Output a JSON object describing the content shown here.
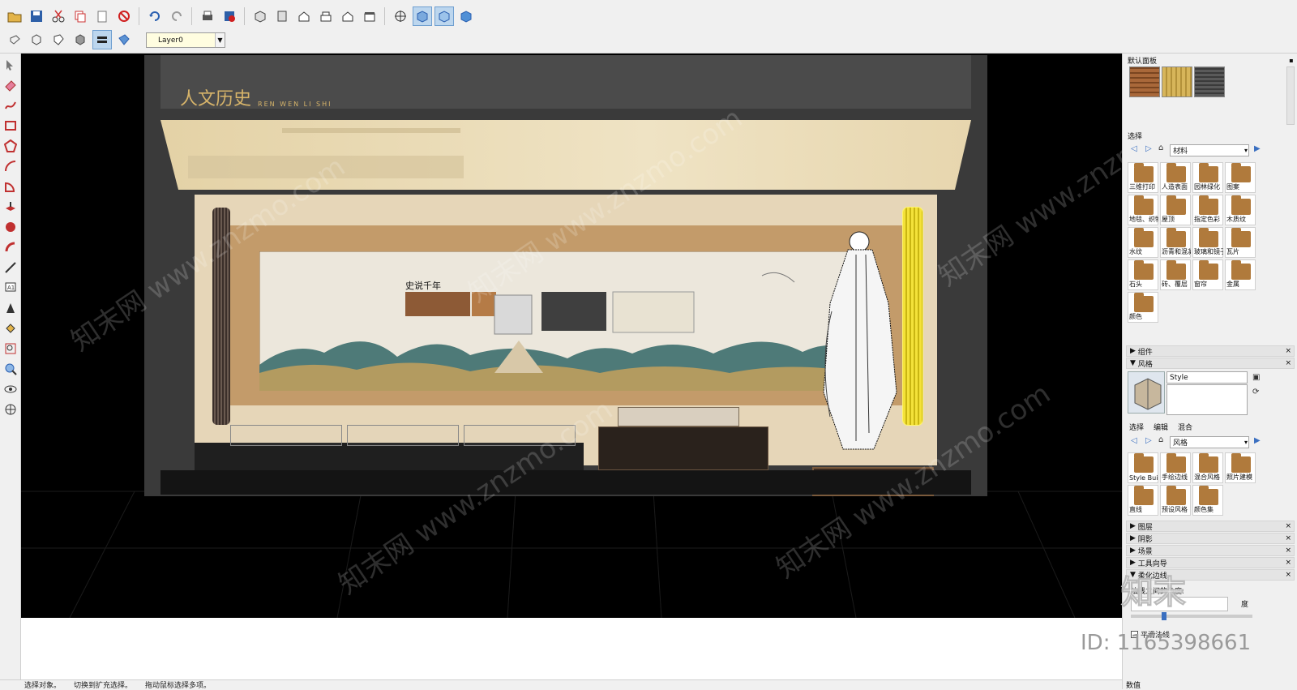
{
  "toolbar": {
    "layer_value": "Layer0"
  },
  "status": {
    "items": [
      "选择对象。",
      "切换到扩充选择。",
      "拖动鼠标选择多项。"
    ],
    "measurement_label": "数值"
  },
  "scene": {
    "title": "人文历史",
    "subtitle": "REN WEN LI SHI",
    "scroll_title": "史说千年",
    "watermark": "知末网 www.znzmo.com"
  },
  "panel": {
    "tray_title": "默认面板",
    "select_label": "选择",
    "material_combo": "材料",
    "materials": [
      "三维打印",
      "人造表面",
      "园林绿化",
      "图案",
      "地毯、织物",
      "屋顶",
      "指定色彩",
      "木质纹",
      "水纹",
      "沥青和混凝土",
      "玻璃和镜子",
      "瓦片",
      "石头",
      "砖、覆层",
      "窗帘",
      "金属",
      "颜色"
    ],
    "components_label": "组件",
    "styles_label": "风格",
    "style_name": "Style",
    "style_tabs": [
      "选择",
      "编辑",
      "混合"
    ],
    "style_combo": "风格",
    "styles": [
      "Style Builder",
      "手绘边线",
      "混合风格",
      "照片建模",
      "直线",
      "预设风格",
      "颜色集"
    ],
    "collapsed": [
      "图层",
      "阴影",
      "场景",
      "工具向导"
    ],
    "soften_label": "柔化边线",
    "soften_angle_label": "法线之间的角度:",
    "soften_unit": "度",
    "smooth_label": "平滑法线",
    "id_text": "ID: 1165398661",
    "brand": "知末"
  },
  "colors": {
    "accent": "#3a6fc0",
    "viewport_bg": "#000000",
    "wall": "#e6d6b8",
    "frame": "#c39b6a"
  }
}
